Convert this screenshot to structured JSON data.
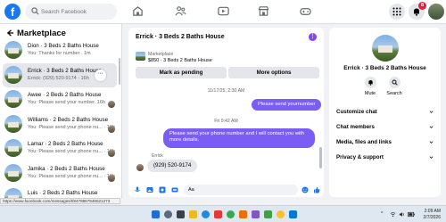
{
  "topbar": {
    "logo": "f",
    "search_placeholder": "Search Facebook",
    "notification_count": "8"
  },
  "sidebar": {
    "title": "Marketplace",
    "conversations": [
      {
        "name": "Dion · 3 Beds 2 Baths House",
        "preview": "You: Thanks for number . 1m",
        "active": false
      },
      {
        "name": "Errick · 3 Beds 2 Baths House",
        "preview": "Errick: (929) 520-9174 · 16h",
        "active": true
      },
      {
        "name": "Awee · 2 Beds 2 Baths House",
        "preview": "You: Please send your number. 16h",
        "active": false
      },
      {
        "name": "Williams · 2 Beds 2 Baths House",
        "preview": "You: Please send your phone nu... · 16h",
        "active": false
      },
      {
        "name": "Lamar · 2 Beds 2 Baths House",
        "preview": "You: Please send your phone nu... · 16h",
        "active": false
      },
      {
        "name": "Jamika · 2 Beds 2 Baths House",
        "preview": "You: Please send your phone nu... · 16h",
        "active": false
      },
      {
        "name": "Luis · 2 Beds 2 Baths House",
        "preview": "",
        "active": false
      }
    ]
  },
  "chat": {
    "title": "Errick · 3 Beds 2 Baths House",
    "listing_kind": "Marketplace",
    "listing_price_title": "$850 · 3 Beds 2 Baths House",
    "mark_pending_label": "Mark as pending",
    "more_options_label": "More options",
    "timestamp_1": "11/17/25, 2:30 AM",
    "msg_1": "Please send yournumber",
    "timestamp_2": "Fri 9:42 AM",
    "msg_2": "Please send your phone number and I will contact you with more details.",
    "sender": "Errick",
    "msg_3": "(929) 520-9174",
    "composer_value": "Aa"
  },
  "info": {
    "name": "Errick · 3 Beds 2 Baths House",
    "mute_label": "Mute",
    "search_label": "Search",
    "rows": [
      "Customize chat",
      "Chat members",
      "Media, files and links",
      "Privacy & support"
    ]
  },
  "statusbar": {
    "url": "https://www.facebook.com/messages/t/8478867946621273"
  },
  "taskbar": {
    "time": "2:09 AM",
    "date": "2/7/2026"
  },
  "colors": {
    "brand": "#1877f2",
    "message_bubble": "#7b5cf5",
    "badge": "#e41e3f"
  }
}
